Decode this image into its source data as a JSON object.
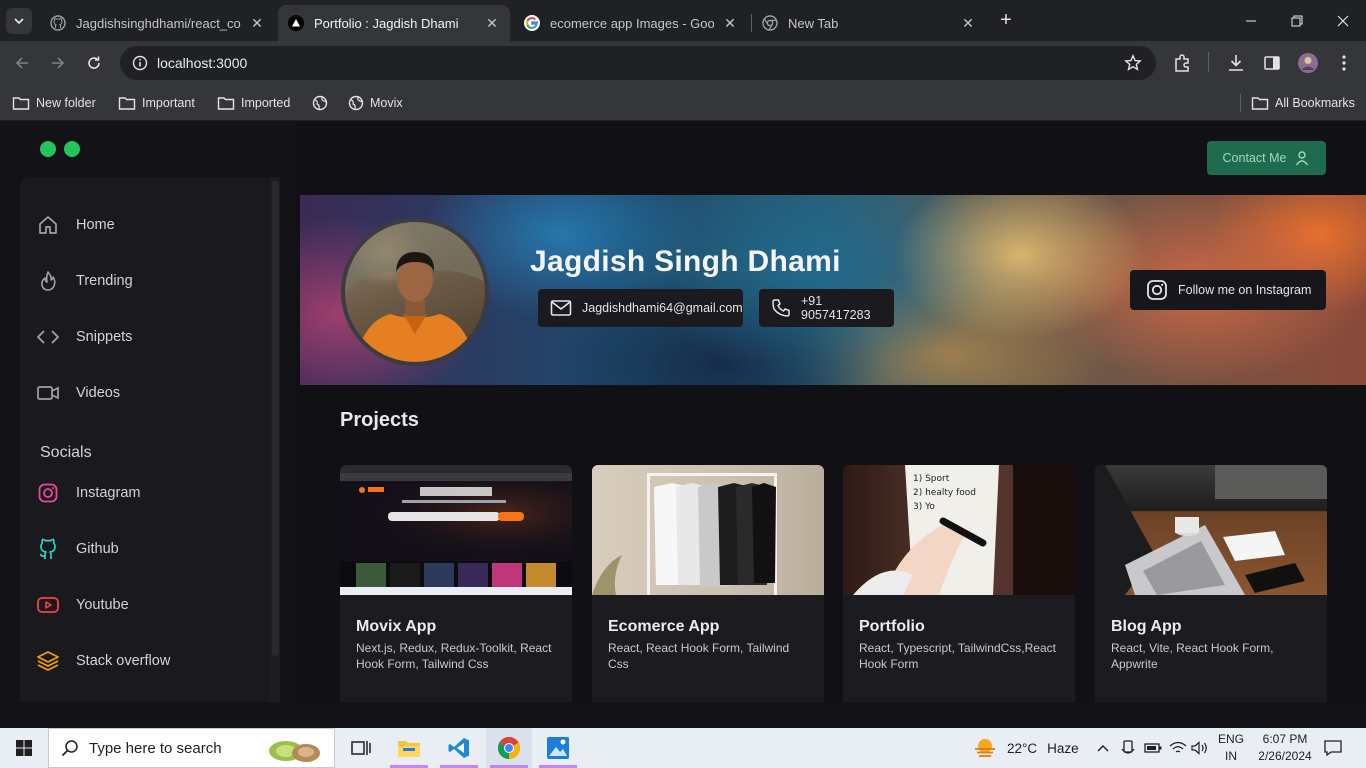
{
  "browser": {
    "tabs": [
      {
        "label": "Jagdishsinghdhami/react_cours",
        "icon": "github-icon",
        "active": false
      },
      {
        "label": "Portfolio : Jagdish Dhami",
        "icon": "vercel-triangle-icon",
        "active": true
      },
      {
        "label": "ecomerce app Images - Google",
        "icon": "google-icon",
        "active": false
      },
      {
        "label": "New Tab",
        "icon": "chrome-icon",
        "active": false
      }
    ],
    "url": "localhost:3000",
    "bookmarks": [
      {
        "label": "New folder",
        "icon": "folder-icon"
      },
      {
        "label": "Important",
        "icon": "folder-icon"
      },
      {
        "label": "Imported",
        "icon": "folder-icon"
      },
      {
        "label": "",
        "icon": "globe-icon"
      },
      {
        "label": "Movix",
        "icon": "globe-icon"
      }
    ],
    "all_bookmarks": "All Bookmarks"
  },
  "sidebar": {
    "nav": [
      {
        "label": "Home",
        "icon": "home-icon"
      },
      {
        "label": "Trending",
        "icon": "flame-icon"
      },
      {
        "label": "Snippets",
        "icon": "code-icon"
      },
      {
        "label": "Videos",
        "icon": "video-icon"
      }
    ],
    "socials_heading": "Socials",
    "socials": [
      {
        "label": "Instagram",
        "icon": "instagram-icon",
        "color": "#ec4899"
      },
      {
        "label": "Github",
        "icon": "github-icon",
        "color": "#2dd4bf"
      },
      {
        "label": "Youtube",
        "icon": "youtube-icon",
        "color": "#ef4444"
      },
      {
        "label": "Stack overflow",
        "icon": "stack-icon",
        "color": "#f59e0b"
      }
    ]
  },
  "header": {
    "contact_label": "Contact Me",
    "accent": "#1f6b4f"
  },
  "profile": {
    "name": "Jagdish Singh Dhami",
    "email": "Jagdishdhami64@gmail.com",
    "phone": "+91 9057417283",
    "instagram_label": "Follow me on Instagram"
  },
  "projects": {
    "heading": "Projects",
    "items": [
      {
        "title": "Movix App",
        "tech": "Next.js, Redux, Redux-Toolkit, React Hook Form, Tailwind Css"
      },
      {
        "title": "Ecomerce App",
        "tech": "React, React Hook Form, Tailwind Css"
      },
      {
        "title": "Portfolio",
        "tech": "React, Typescript, TailwindCss,React Hook Form"
      },
      {
        "title": "Blog App",
        "tech": "React, Vite, React Hook Form, Appwrite"
      }
    ]
  },
  "taskbar": {
    "search_placeholder": "Type here to search",
    "weather_temp": "22°C",
    "weather_desc": "Haze",
    "lang_top": "ENG",
    "lang_bottom": "IN",
    "time": "6:07 PM",
    "date": "2/26/2024"
  }
}
